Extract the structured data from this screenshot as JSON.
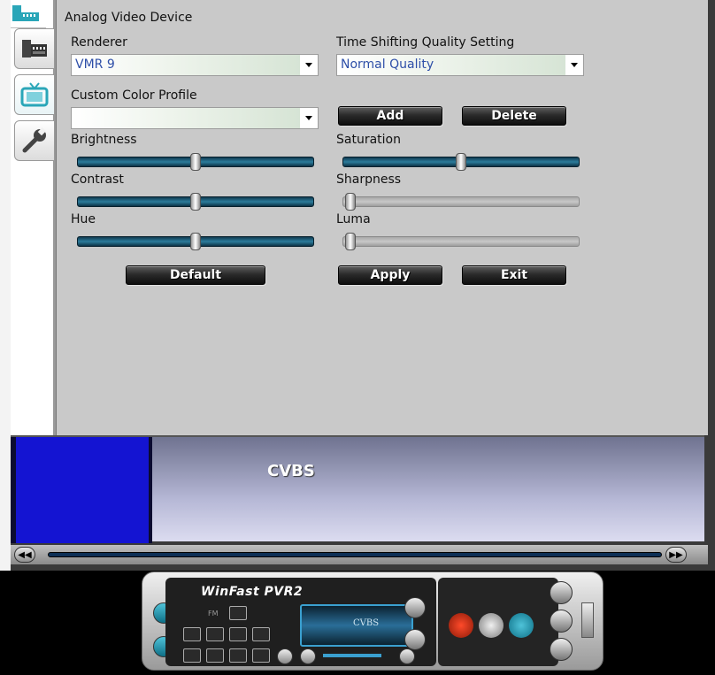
{
  "dialog": {
    "title": "Analog Video Device",
    "renderer_label": "Renderer",
    "renderer_value": "VMR 9",
    "timeshift_label": "Time Shifting Quality Setting",
    "timeshift_value": "Normal Quality",
    "color_profile_label": "Custom Color Profile",
    "color_profile_value": "",
    "add_label": "Add",
    "delete_label": "Delete",
    "default_label": "Default",
    "apply_label": "Apply",
    "exit_label": "Exit"
  },
  "sliders": {
    "brightness": {
      "label": "Brightness",
      "value": 0.5,
      "enabled": true
    },
    "saturation": {
      "label": "Saturation",
      "value": 0.5,
      "enabled": true
    },
    "contrast": {
      "label": "Contrast",
      "value": 0.5,
      "enabled": true
    },
    "sharpness": {
      "label": "Sharpness",
      "value": 0.0,
      "enabled": false
    },
    "hue": {
      "label": "Hue",
      "value": 0.5,
      "enabled": true
    },
    "luma": {
      "label": "Luma",
      "value": 0.0,
      "enabled": false
    }
  },
  "preview": {
    "source_label": "CVBS"
  },
  "remote": {
    "brand": "WinFast PVR2",
    "lcd_text": "CVBS",
    "fm_label": "FM"
  },
  "tabs": [
    {
      "name": "capture-tab",
      "icon": "film-icon",
      "active": false
    },
    {
      "name": "display-tab",
      "icon": "tv-icon",
      "active": true
    },
    {
      "name": "tools-tab",
      "icon": "wrench-icon",
      "active": false
    }
  ],
  "colors": {
    "panel": "#c9c9c9",
    "slider_active": "#2c7c9c",
    "combo_text": "#2e4fa8",
    "preview_blue": "#1414d2"
  }
}
